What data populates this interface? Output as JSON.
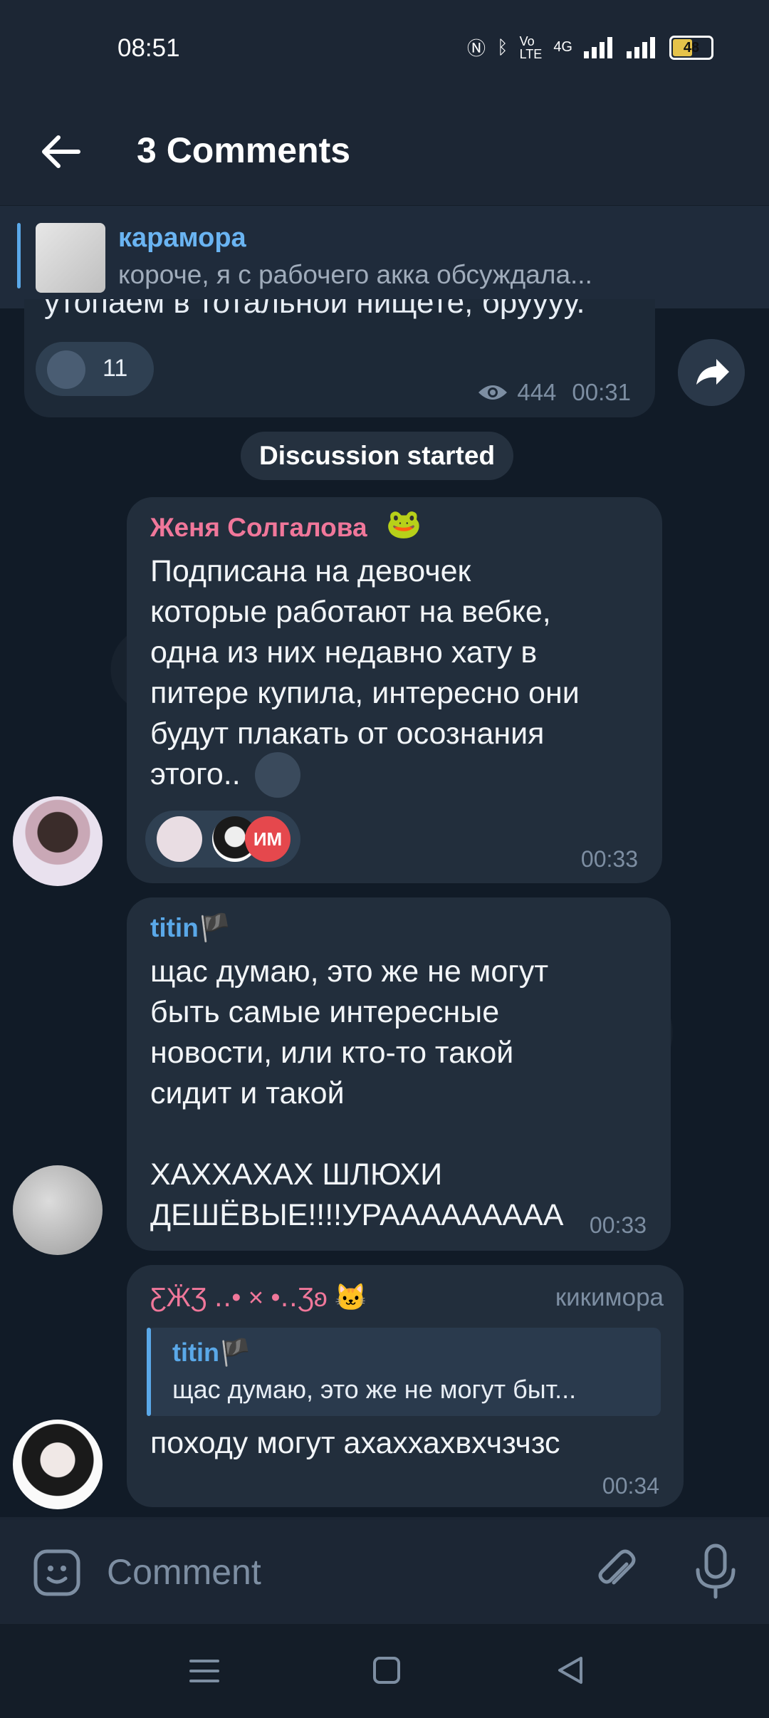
{
  "status_bar": {
    "time": "08:51",
    "network": "4G",
    "battery": "48"
  },
  "header": {
    "title": "3 Comments"
  },
  "pinned": {
    "name": "карамора",
    "text": "короче, я с рабочего акка обсуждала..."
  },
  "post": {
    "cut_text": "утопаем в тотальной нищете, бруууу.",
    "reaction_count": "11",
    "views": "444",
    "time": "00:31"
  },
  "service": {
    "label": "Discussion started"
  },
  "comments": [
    {
      "author": "Женя Солгалова",
      "author_color": "#f0779a",
      "text": "Подписана на девочек\nкоторые работают на вебке,\nодна из них недавно хату в\nпитере купила, интересно они\nбудут плакать от осознания\nэтого..",
      "reaction_badge": "ИМ",
      "time": "00:33"
    },
    {
      "author": "titin🏴",
      "author_color": "#5aa8e8",
      "text": "щас думаю, это же не могут\nбыть самые интересные\nновости, или кто-то такой\nсидит и такой\n\nХАХХАХАХ ШЛЮХИ\nДЕШЁВЫЕ!!!!УРААААААААА",
      "time": "00:33"
    },
    {
      "author": "ƸӜƷ ‥• × •‥Ʒʚ 🐱",
      "author_color": "#f0779a",
      "title": "кикимора",
      "reply_author": "titin🏴",
      "reply_text": "щас думаю, это же не могут быт...",
      "text": "походу могут ахаххахвхчзчзс",
      "time": "00:34"
    }
  ],
  "input": {
    "placeholder": "Comment"
  }
}
